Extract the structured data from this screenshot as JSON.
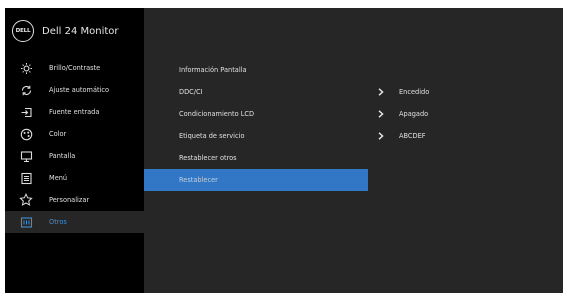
{
  "header": {
    "logo_text": "DELL",
    "title": "Dell 24 Monitor"
  },
  "sidebar": {
    "items": [
      {
        "label": "Brillo/Contraste",
        "icon": "brightness-icon"
      },
      {
        "label": "Ajuste automático",
        "icon": "auto-adjust-icon"
      },
      {
        "label": "Fuente entrada",
        "icon": "input-source-icon"
      },
      {
        "label": "Color",
        "icon": "color-icon"
      },
      {
        "label": "Pantalla",
        "icon": "display-icon"
      },
      {
        "label": "Menú",
        "icon": "menu-icon"
      },
      {
        "label": "Personalizar",
        "icon": "personalize-star-icon"
      },
      {
        "label": "Otros",
        "icon": "others-icon"
      }
    ],
    "active_index": 7
  },
  "main": {
    "rows": [
      {
        "label": "Información Pantalla",
        "value": ""
      },
      {
        "label": "DDC/CI",
        "value": "Encedido"
      },
      {
        "label": "Condicionamiento LCD",
        "value": "Apagado"
      },
      {
        "label": "Etiqueta de servicio",
        "value": "ABCDEF"
      },
      {
        "label": "Restablecer otros",
        "value": ""
      },
      {
        "label": "Restablecer",
        "value": ""
      }
    ],
    "selected_index": 5
  },
  "colors": {
    "accent": "#3277c5",
    "active_text": "#3f8fd4",
    "panel_bg": "#262626",
    "sidebar_bg": "#000000"
  }
}
